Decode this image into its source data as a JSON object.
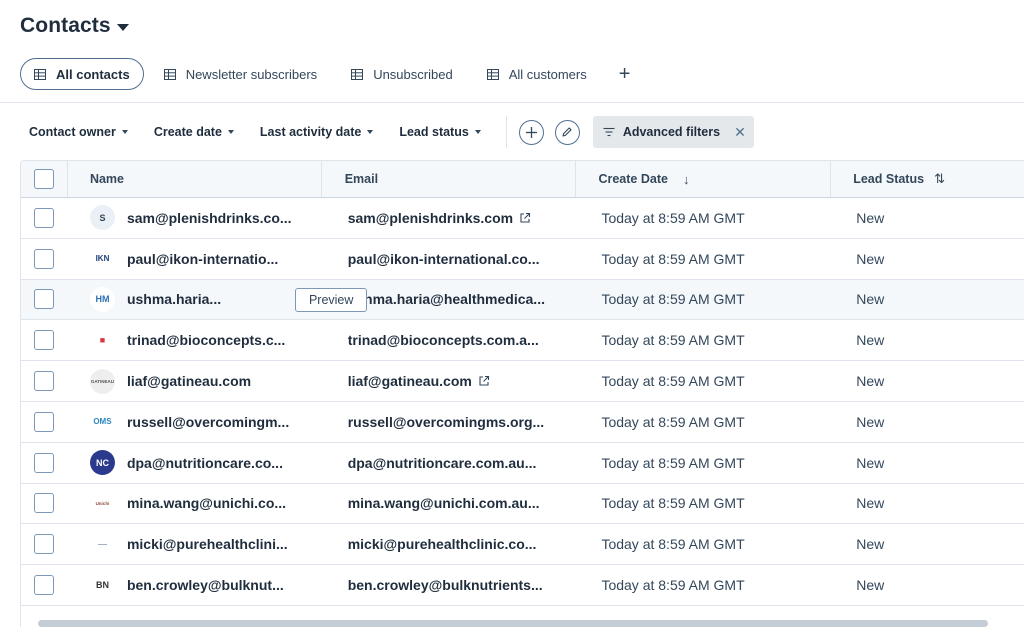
{
  "header": {
    "title": "Contacts"
  },
  "views": [
    {
      "label": "All contacts",
      "active": true
    },
    {
      "label": "Newsletter subscribers",
      "active": false
    },
    {
      "label": "Unsubscribed",
      "active": false
    },
    {
      "label": "All customers",
      "active": false
    }
  ],
  "add_view_symbol": "+",
  "filters": {
    "contact_owner": "Contact owner",
    "create_date": "Create date",
    "last_activity": "Last activity date",
    "lead_status": "Lead status",
    "advanced": "Advanced filters",
    "close": "✕"
  },
  "table": {
    "columns": {
      "name": "Name",
      "email": "Email",
      "create_date": "Create Date",
      "lead_status": "Lead Status"
    },
    "sort_desc": "↓",
    "sort_both": "⇅",
    "preview_label": "Preview",
    "rows": [
      {
        "name": "sam@plenishdrinks.co...",
        "email": "sam@plenishdrinks.com",
        "date": "Today at 8:59 AM GMT",
        "status": "New",
        "logo": "S",
        "logo_color": "#33475b",
        "logo_bg": "#eaf0f6",
        "ext": true
      },
      {
        "name": "paul@ikon-internatio...",
        "email": "paul@ikon-international.co...",
        "date": "Today at 8:59 AM GMT",
        "status": "New",
        "logo": "IKN",
        "logo_color": "#1c3f7a",
        "logo_bg": "#ffffff",
        "ext": false
      },
      {
        "name": "ushma.haria...",
        "email": "ushma.haria@healthmedica...",
        "date": "Today at 8:59 AM GMT",
        "status": "New",
        "logo": "HM",
        "logo_color": "#2e6fb5",
        "logo_bg": "#ffffff",
        "ext": false,
        "hovered": true
      },
      {
        "name": "trinad@bioconcepts.c...",
        "email": "trinad@bioconcepts.com.a...",
        "date": "Today at 8:59 AM GMT",
        "status": "New",
        "logo": "■",
        "logo_color": "#d9363e",
        "logo_bg": "#ffffff",
        "ext": false
      },
      {
        "name": "liaf@gatineau.com",
        "email": "liaf@gatineau.com",
        "date": "Today at 8:59 AM GMT",
        "status": "New",
        "logo": "GATINEAU",
        "logo_color": "#555555",
        "logo_bg": "#eeeeee",
        "ext": true
      },
      {
        "name": "russell@overcomingm...",
        "email": "russell@overcomingms.org...",
        "date": "Today at 8:59 AM GMT",
        "status": "New",
        "logo": "OMS",
        "logo_color": "#2e86c1",
        "logo_bg": "#ffffff",
        "ext": false
      },
      {
        "name": "dpa@nutritioncare.co...",
        "email": "dpa@nutritioncare.com.au...",
        "date": "Today at 8:59 AM GMT",
        "status": "New",
        "logo": "NC",
        "logo_color": "#ffffff",
        "logo_bg": "#2b3a8c",
        "ext": false
      },
      {
        "name": "mina.wang@unichi.co...",
        "email": "mina.wang@unichi.com.au...",
        "date": "Today at 8:59 AM GMT",
        "status": "New",
        "logo": "Unichi",
        "logo_color": "#8a4b3a",
        "logo_bg": "#ffffff",
        "ext": false
      },
      {
        "name": "micki@purehealthclini...",
        "email": "micki@purehealthclinic.co...",
        "date": "Today at 8:59 AM GMT",
        "status": "New",
        "logo": "—",
        "logo_color": "#9aa9bb",
        "logo_bg": "#ffffff",
        "ext": false
      },
      {
        "name": "ben.crowley@bulknut...",
        "email": "ben.crowley@bulknutrients...",
        "date": "Today at 8:59 AM GMT",
        "status": "New",
        "logo": "BN",
        "logo_color": "#333333",
        "logo_bg": "#ffffff",
        "ext": false
      }
    ]
  }
}
